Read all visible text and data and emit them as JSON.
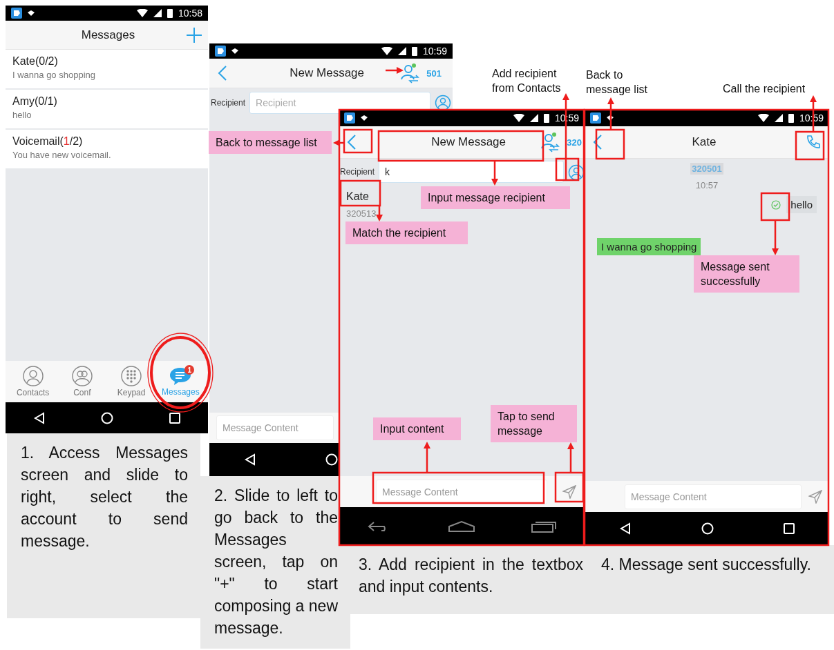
{
  "screens": [
    {
      "kind": "conversation-list",
      "time": "10:58",
      "title": "Messages",
      "conversations": [
        {
          "name": "Kate(",
          "unread": "0",
          "total": "/2)",
          "has_unread": false,
          "preview": "I wanna go shopping"
        },
        {
          "name": "Amy(",
          "unread": "0",
          "total": "/1)",
          "has_unread": false,
          "preview": "hello"
        },
        {
          "name": "Voicemail(",
          "unread": "1",
          "total": "/2)",
          "has_unread": true,
          "preview": "You have new voicemail."
        }
      ],
      "tabs": [
        {
          "label": "Contacts",
          "selected": false
        },
        {
          "label": "Conf",
          "selected": false
        },
        {
          "label": "Keypad",
          "selected": false
        },
        {
          "label": "Messages",
          "selected": true,
          "badge": "1"
        }
      ]
    },
    {
      "kind": "compose",
      "time": "10:59",
      "title": "New Message",
      "account": "501",
      "recipient_label": "Recipient",
      "recipient_placeholder": "Recipient",
      "message_placeholder": "Message Content"
    },
    {
      "kind": "compose",
      "time": "10:59",
      "title": "New Message",
      "account": "320",
      "recipient_label": "Recipient",
      "recipient_value": "k",
      "match": {
        "name": "Kate",
        "number": "320513"
      },
      "message_placeholder": "Message Content"
    },
    {
      "kind": "chat",
      "time": "10:59",
      "title": "Kate",
      "number": "320501",
      "timestamp": "10:57",
      "messages": [
        {
          "text": "hello",
          "outgoing": true,
          "delivered": true
        },
        {
          "text": "I wanna go shopping",
          "outgoing": false
        }
      ],
      "message_placeholder": "Message Content"
    }
  ],
  "captions": [
    "1. Access Messages screen and slide to right, select the account to send message.",
    "2. Slide to left to go back to the Messages screen, tap on \"+\" to start composing a new message.",
    "3. Add recipient in the textbox and input contents.",
    "4. Message sent successfully."
  ],
  "callouts": [
    {
      "text": "Back to message list",
      "kind": "highlight"
    },
    {
      "text": "Add recipient from Contacts",
      "kind": "plain"
    },
    {
      "text": "Input message recipient",
      "kind": "highlight"
    },
    {
      "text": "Match the recipient",
      "kind": "highlight"
    },
    {
      "text": "Input content",
      "kind": "highlight"
    },
    {
      "text": "Tap to send message",
      "kind": "highlight"
    },
    {
      "text": "Back to message list",
      "kind": "plain"
    },
    {
      "text": "Call the recipient",
      "kind": "plain"
    },
    {
      "text": "Message sent successfully",
      "kind": "highlight"
    }
  ]
}
